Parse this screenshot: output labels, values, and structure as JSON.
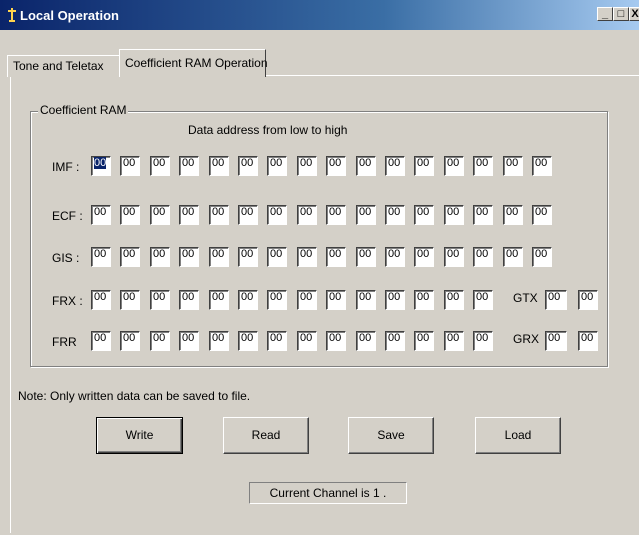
{
  "window": {
    "title": "Local Operation",
    "min_glyph": "_",
    "max_glyph": "□",
    "close_glyph": "X"
  },
  "tabs": [
    {
      "label": "Tone and Teletax",
      "active": false
    },
    {
      "label": "Coefficient RAM Operation",
      "active": true
    }
  ],
  "group": {
    "title": "Coefficient RAM",
    "subtitle": "Data address from low to high"
  },
  "rows": [
    {
      "label": "IMF :",
      "values": [
        "00",
        "00",
        "00",
        "00",
        "00",
        "00",
        "00",
        "00",
        "00",
        "00",
        "00",
        "00",
        "00",
        "00",
        "00",
        "00"
      ]
    },
    {
      "label": "ECF :",
      "values": [
        "00",
        "00",
        "00",
        "00",
        "00",
        "00",
        "00",
        "00",
        "00",
        "00",
        "00",
        "00",
        "00",
        "00",
        "00",
        "00"
      ]
    },
    {
      "label": "GIS :",
      "values": [
        "00",
        "00",
        "00",
        "00",
        "00",
        "00",
        "00",
        "00",
        "00",
        "00",
        "00",
        "00",
        "00",
        "00",
        "00",
        "00"
      ]
    },
    {
      "label": "FRX :",
      "values": [
        "00",
        "00",
        "00",
        "00",
        "00",
        "00",
        "00",
        "00",
        "00",
        "00",
        "00",
        "00",
        "00",
        "00"
      ]
    },
    {
      "label": "FRR",
      "values": [
        "00",
        "00",
        "00",
        "00",
        "00",
        "00",
        "00",
        "00",
        "00",
        "00",
        "00",
        "00",
        "00",
        "00"
      ]
    }
  ],
  "extras": {
    "gtx": {
      "label": "GTX",
      "values": [
        "00",
        "00"
      ]
    },
    "grx": {
      "label": "GRX",
      "values": [
        "00",
        "00"
      ]
    }
  },
  "note": "Note: Only written data can be saved to file.",
  "buttons": {
    "write": "Write",
    "read": "Read",
    "save": "Save",
    "load": "Load"
  },
  "status": "Current Channel is 1 ."
}
